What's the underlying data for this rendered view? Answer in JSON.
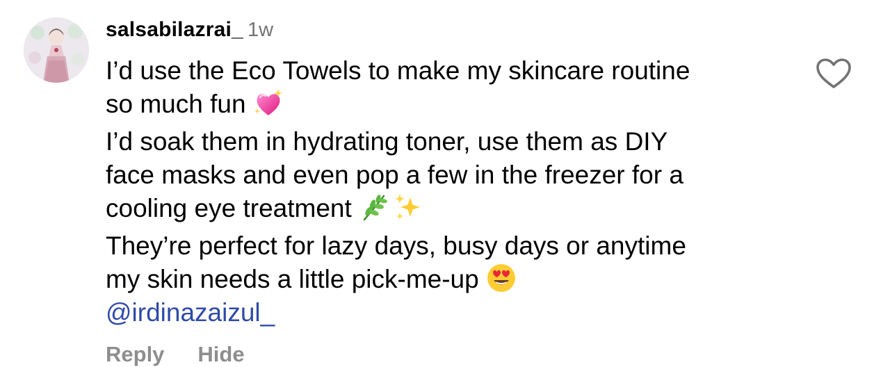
{
  "comment": {
    "username": "salsabilazrai_",
    "time": "1w",
    "paragraphs": [
      {
        "lines": [
          "I’d use the Eco Towels to make my skincare routine",
          "so much fun"
        ],
        "emoji": [
          "sparkling-heart-emoji"
        ]
      },
      {
        "lines": [
          "I’d soak them in hydrating toner, use them as DIY",
          "face masks and even pop a few in the freezer for a",
          "cooling eye treatment"
        ],
        "emoji": [
          "herb-emoji",
          "sparkles-emoji"
        ]
      },
      {
        "lines": [
          "They’re perfect for lazy days, busy days or anytime",
          "my skin needs a little pick-me-up"
        ],
        "emoji": [
          "heart-eyes-emoji"
        ]
      }
    ],
    "mention": "@irdinazaizul_",
    "actions": {
      "reply_label": "Reply",
      "hide_label": "Hide"
    },
    "like_icon": "heart-outline-icon",
    "colors": {
      "mention": "#2f4aa8",
      "secondary": "#8e8e8e",
      "timestamp": "#737373"
    }
  }
}
